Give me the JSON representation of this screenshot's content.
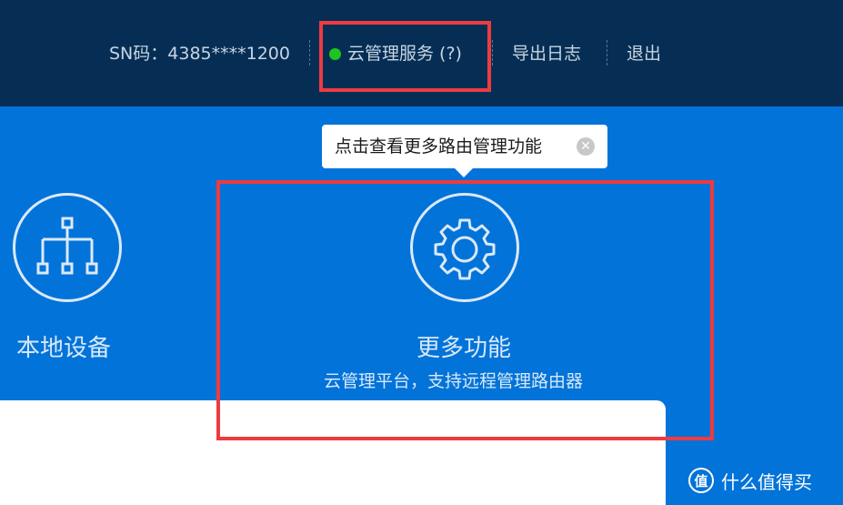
{
  "topbar": {
    "sn": "SN码：4385****1200",
    "cloud_service": "云管理服务 (?)",
    "export_log": "导出日志",
    "logout": "退出"
  },
  "tooltip": {
    "text": "点击查看更多路由管理功能",
    "close_glyph": "✕"
  },
  "tiles": {
    "local_devices": {
      "label": "本地设备",
      "icon": "network-topology-icon"
    },
    "more_functions": {
      "label": "更多功能",
      "desc": "云管理平台，支持远程管理路由器",
      "icon": "gear-icon"
    }
  },
  "watermark": {
    "glyph": "值",
    "text": "什么值得买"
  },
  "colors": {
    "topbar_bg": "#062e55",
    "main_bg": "#0273d9",
    "status_online": "#1fc41f",
    "highlight_red": "#ed3b3f"
  }
}
